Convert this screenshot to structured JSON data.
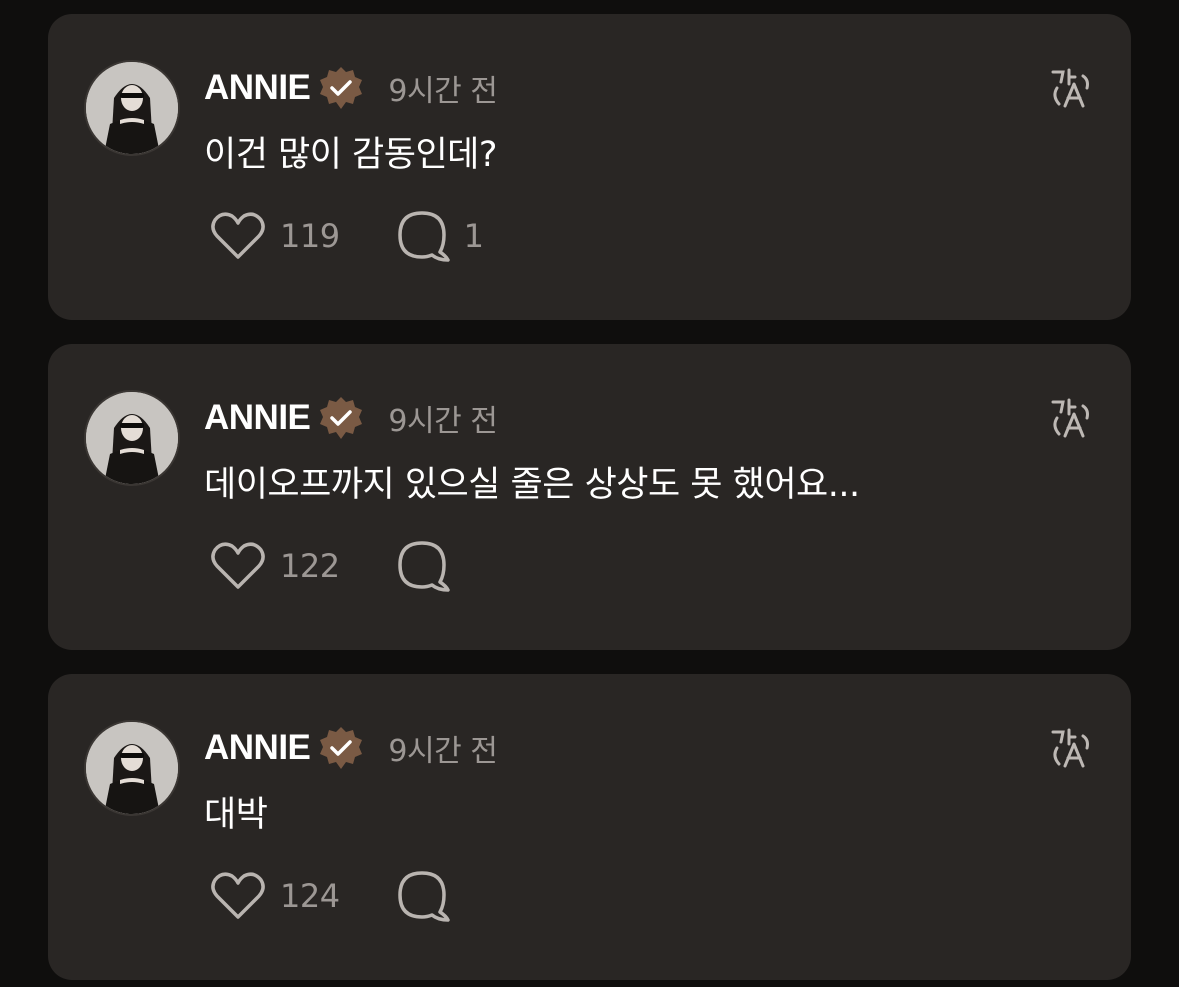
{
  "colors": {
    "background": "#0f0e0d",
    "card": "#292624",
    "badge": "#7a5a44",
    "muted_text": "#9c9794"
  },
  "comments": [
    {
      "author": "ANNIE",
      "verified": true,
      "time": "9시간 전",
      "text": "이건 많이 감동인데?",
      "likes": "119",
      "replies": "1"
    },
    {
      "author": "ANNIE",
      "verified": true,
      "time": "9시간 전",
      "text": "데이오프까지 있으실 줄은 상상도 못 했어요...",
      "likes": "122",
      "replies": ""
    },
    {
      "author": "ANNIE",
      "verified": true,
      "time": "9시간 전",
      "text": "대박",
      "likes": "124",
      "replies": ""
    }
  ],
  "icons": {
    "verified": "verified-badge-icon",
    "translate": "translate-icon",
    "like": "heart-icon",
    "reply": "speech-bubble-icon"
  }
}
